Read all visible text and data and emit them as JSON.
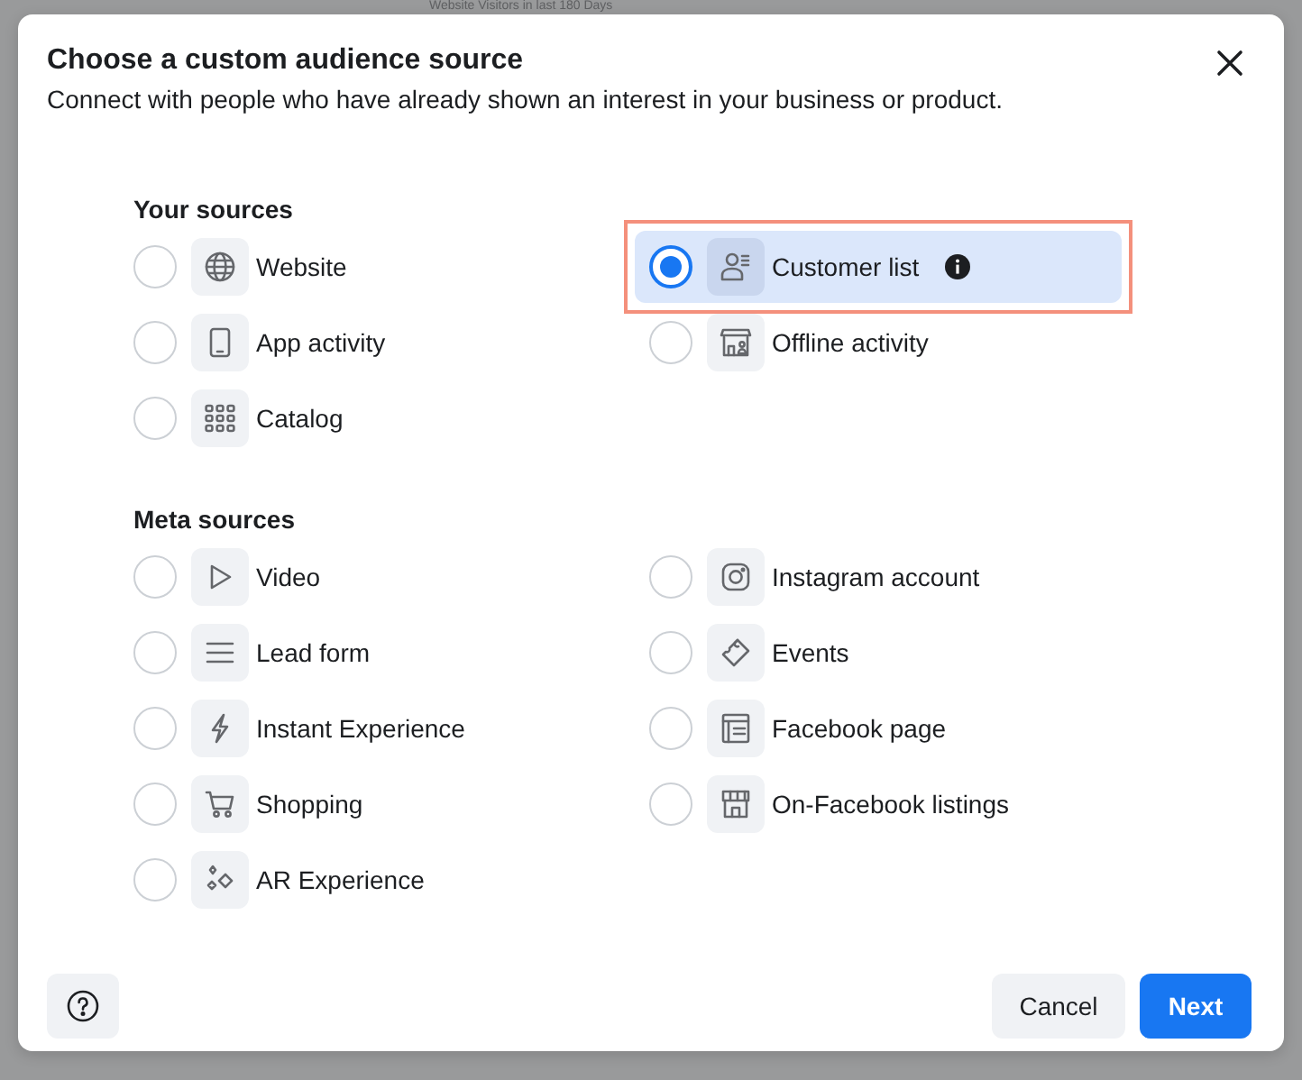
{
  "background": {
    "list_item": "Website Visitors in last 180 Days"
  },
  "dialog": {
    "title": "Choose a custom audience source",
    "subtitle": "Connect with people who have already shown an interest in your business or product."
  },
  "sections": [
    {
      "title": "Your sources",
      "columns": [
        [
          {
            "label": "Website",
            "selected": false
          },
          {
            "label": "App activity",
            "selected": false
          },
          {
            "label": "Catalog",
            "selected": false
          }
        ],
        [
          {
            "label": "Customer list",
            "selected": true,
            "info": true,
            "highlighted": true
          },
          {
            "label": "Offline activity",
            "selected": false
          }
        ]
      ]
    },
    {
      "title": "Meta sources",
      "columns": [
        [
          {
            "label": "Video",
            "selected": false
          },
          {
            "label": "Lead form",
            "selected": false
          },
          {
            "label": "Instant Experience",
            "selected": false
          },
          {
            "label": "Shopping",
            "selected": false
          },
          {
            "label": "AR Experience",
            "selected": false
          }
        ],
        [
          {
            "label": "Instagram account",
            "selected": false
          },
          {
            "label": "Events",
            "selected": false
          },
          {
            "label": "Facebook page",
            "selected": false
          },
          {
            "label": "On-Facebook listings",
            "selected": false
          }
        ]
      ]
    }
  ],
  "footer": {
    "cancel": "Cancel",
    "next": "Next"
  }
}
